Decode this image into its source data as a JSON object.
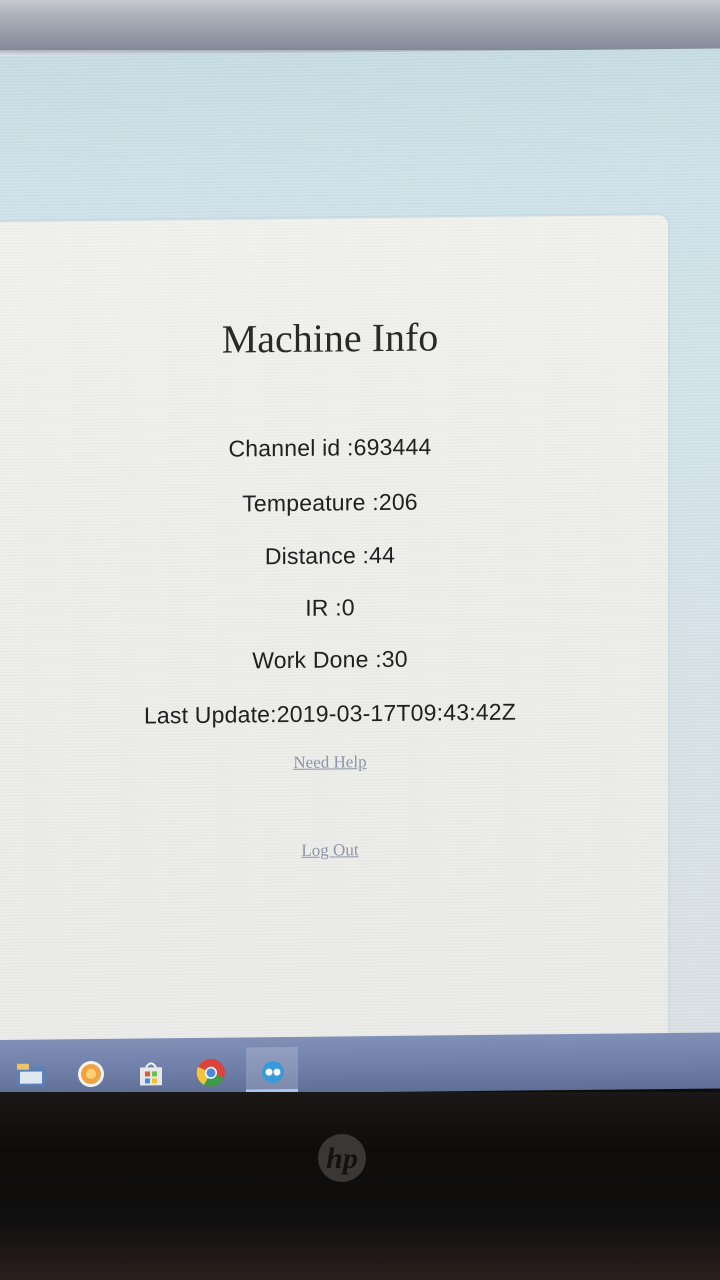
{
  "page": {
    "title": "Machine Info",
    "fields": [
      {
        "label": "Channel id",
        "value": "693444",
        "text": "Channel id :693444"
      },
      {
        "label": "Tempeature",
        "value": "206",
        "text": "Tempeature :206"
      },
      {
        "label": "Distance",
        "value": "44",
        "text": "Distance :44"
      },
      {
        "label": "IR",
        "value": "0",
        "text": "IR :0"
      },
      {
        "label": "Work Done",
        "value": "30",
        "text": "Work Done :30"
      },
      {
        "label": "Last Update",
        "value": "2019-03-17T09:43:42Z",
        "text": "Last Update:2019-03-17T09:43:42Z"
      }
    ],
    "links": {
      "need_help": "Need Help",
      "log_out": "Log Out"
    }
  },
  "taskbar": {
    "icons": [
      "file-explorer-icon",
      "browser-icon",
      "store-icon",
      "chrome-icon",
      "app-icon"
    ]
  },
  "bezel": {
    "logo": "hp"
  },
  "colors": {
    "link": "#8e94a6",
    "text": "#202020",
    "taskbar": "#6f7fa8",
    "screen_background": "#cfe3ea"
  }
}
